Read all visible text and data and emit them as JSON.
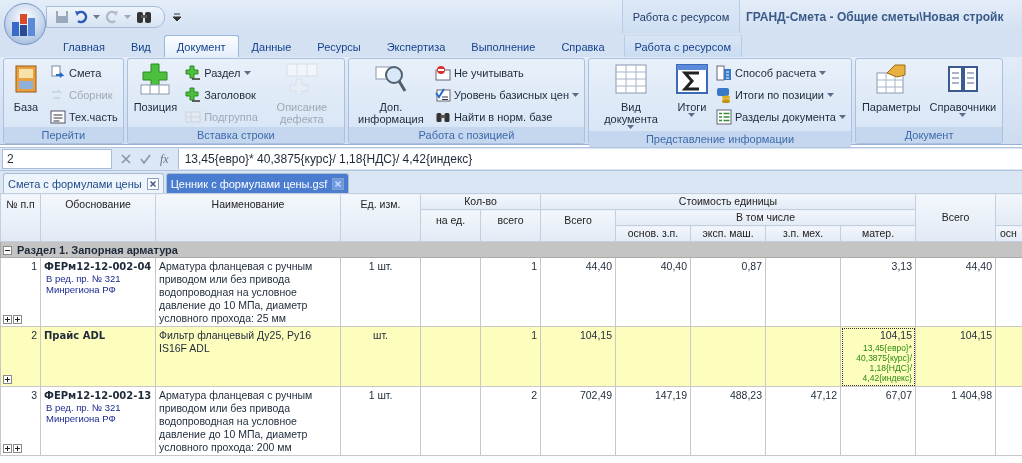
{
  "app": {
    "title": "ГРАНД-Смета - Общие сметы\\Новая стройк",
    "context_header": "Работа с ресурсом"
  },
  "ribbon_tabs": [
    {
      "label": "Главная",
      "selected": false,
      "kind": "normal"
    },
    {
      "label": "Вид",
      "selected": false,
      "kind": "normal"
    },
    {
      "label": "Документ",
      "selected": true,
      "kind": "normal"
    },
    {
      "label": "Данные",
      "selected": false,
      "kind": "normal"
    },
    {
      "label": "Ресурсы",
      "selected": false,
      "kind": "normal"
    },
    {
      "label": "Экспертиза",
      "selected": false,
      "kind": "normal"
    },
    {
      "label": "Выполнение",
      "selected": false,
      "kind": "normal"
    },
    {
      "label": "Справка",
      "selected": false,
      "kind": "normal"
    },
    {
      "label": "Работа с ресурсом",
      "selected": false,
      "kind": "context"
    }
  ],
  "ribbon_groups": [
    {
      "title": "Перейти",
      "items": [
        {
          "label": "База",
          "kind": "large",
          "disabled": false,
          "dropdown": false
        },
        {
          "label": "Смета",
          "kind": "small",
          "disabled": false,
          "dropdown": false
        },
        {
          "label": "Сборник",
          "kind": "small",
          "disabled": true,
          "dropdown": false
        },
        {
          "label": "Тех.часть",
          "kind": "small",
          "disabled": false,
          "dropdown": false
        }
      ]
    },
    {
      "title": "Вставка строки",
      "items": [
        {
          "label": "Позиция",
          "kind": "large",
          "disabled": false,
          "dropdown": false
        },
        {
          "label": "Раздел",
          "kind": "small",
          "disabled": false,
          "dropdown": true
        },
        {
          "label": "Заголовок",
          "kind": "small",
          "disabled": false,
          "dropdown": false
        },
        {
          "label": "Подгруппа",
          "kind": "small",
          "disabled": true,
          "dropdown": false
        },
        {
          "label": "Описание дефекта",
          "kind": "large",
          "disabled": true,
          "dropdown": false
        }
      ]
    },
    {
      "title": "Работа с позицией",
      "items": [
        {
          "label": "Доп. информация",
          "kind": "large",
          "disabled": false,
          "dropdown": false
        },
        {
          "label": "Не учитывать",
          "kind": "small",
          "disabled": false,
          "dropdown": false
        },
        {
          "label": "Уровень базисных цен",
          "kind": "small",
          "disabled": false,
          "dropdown": true
        },
        {
          "label": "Найти в норм. базе",
          "kind": "small",
          "disabled": false,
          "dropdown": false
        }
      ]
    },
    {
      "title": "Представление информации",
      "items": [
        {
          "label": "Вид документа",
          "kind": "large",
          "disabled": false,
          "dropdown": true
        },
        {
          "label": "Итоги",
          "kind": "large",
          "disabled": false,
          "dropdown": true
        },
        {
          "label": "Способ расчета",
          "kind": "small",
          "disabled": false,
          "dropdown": true
        },
        {
          "label": "Итоги по позиции",
          "kind": "small",
          "disabled": false,
          "dropdown": true
        },
        {
          "label": "Разделы документа",
          "kind": "small",
          "disabled": false,
          "dropdown": true
        }
      ]
    },
    {
      "title": "Документ",
      "items": [
        {
          "label": "Параметры",
          "kind": "large",
          "disabled": false,
          "dropdown": false
        },
        {
          "label": "Справочники",
          "kind": "large",
          "disabled": false,
          "dropdown": true
        }
      ]
    }
  ],
  "formula_bar": {
    "cell": "2",
    "fx": "fx",
    "formula": "13,45{евро}* 40,3875{курс}/ 1,18{НДС}/ 4,42{индекс}"
  },
  "doc_tabs": [
    {
      "label": "Смета с формулами цены",
      "selected": false
    },
    {
      "label": "Ценник с формулами цены.gsf",
      "selected": true
    }
  ],
  "table": {
    "columns": {
      "number": "№ п.п",
      "basis": "Обоснование",
      "name": "Наименование",
      "unit": "Ед. изм.",
      "quantity": "Кол-во",
      "per_unit": "на ед.",
      "quantity_total": "всего",
      "unit_cost": "Стоимость единицы",
      "unit_cost_total": "Всего",
      "including": "В том числе",
      "base_wage": "основ. з.п.",
      "machine_cost": "эксп. маш.",
      "mech_wage": "з.п. мех.",
      "materials": "матер.",
      "total": "Всего",
      "column_13": "осн"
    },
    "section": {
      "title": "Раздел 1. Запорная арматура",
      "expanded": true
    },
    "rows": [
      {
        "number": "1",
        "code": "ФЕРм12-12-002-04",
        "note": [
          "В ред. пр. № 321",
          "Минрегиона РФ"
        ],
        "name": "Арматура фланцевая с ручным приводом или без привода водопроводная на условное давление до 10 МПа, диаметр условного прохода: 25 мм",
        "unit": "1 шт.",
        "quantity_total": "1",
        "unit_total": "44,40",
        "base_wage": "40,40",
        "machine_cost": "0,87",
        "materials": "3,13",
        "total": "44,40",
        "selected": false,
        "toggles": [
          {
            "expanded": false
          },
          {
            "expanded": false
          }
        ]
      },
      {
        "number": "2",
        "code": "Прайс ADL",
        "name": "Фильтр фланцевый Ду25, Ру16 IS16F ADL",
        "unit": "шт.",
        "quantity_total": "1",
        "unit_total": "104,15",
        "materials": "104,15",
        "materials_formula": "13,45{евро}* 40,3875{курс}/ 1,18{НДС}/ 4,42{индекс}",
        "total": "104,15",
        "selected": true,
        "toggles": [
          {
            "expanded": false
          }
        ]
      },
      {
        "number": "3",
        "code": "ФЕРм12-12-002-13",
        "note": [
          "В ред. пр. № 321",
          "Минрегиона РФ"
        ],
        "name": "Арматура фланцевая с ручным приводом или без привода водопроводная на условное давление до 10 МПа, диаметр условного прохода: 200 мм",
        "unit": "1 шт.",
        "quantity_total": "2",
        "unit_total": "702,49",
        "base_wage": "147,19",
        "machine_cost": "488,23",
        "mech_wage": "47,12",
        "materials": "67,07",
        "total": "1 404,98",
        "selected": false,
        "toggles": [
          {
            "expanded": false
          },
          {
            "expanded": false
          }
        ]
      }
    ]
  }
}
